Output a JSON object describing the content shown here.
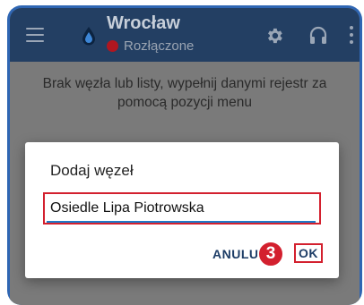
{
  "appbar": {
    "title": "Wrocław",
    "status": "Rozłączone",
    "status_color": "#b01620",
    "icons": [
      "menu-icon",
      "water-drop-icon",
      "gear-icon",
      "headset-icon",
      "more-vert-icon"
    ]
  },
  "main": {
    "empty_message": "Brak węzła lub listy, wypełnij danymi rejestr za pomocą pozycji menu"
  },
  "dialog": {
    "title": "Dodaj węzeł",
    "input_value": "Osiedle Lipa Piotrowska",
    "cancel_label": "ANULUJ",
    "ok_label": "OK",
    "step_badge": "3"
  },
  "colors": {
    "appbar": "#233f63",
    "accent": "#1e7ac8",
    "highlight": "#d3202e",
    "frame": "#2f66b3"
  }
}
